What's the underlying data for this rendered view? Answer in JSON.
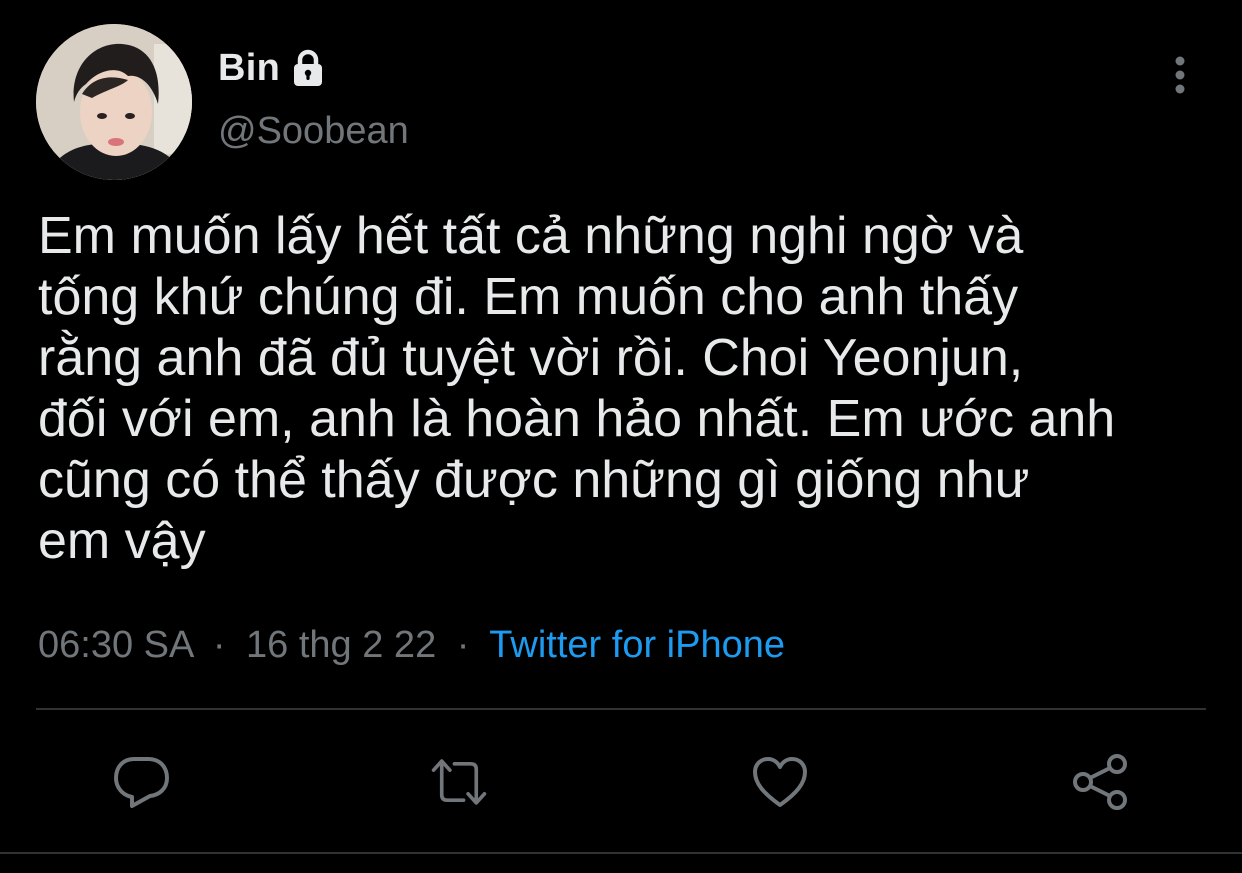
{
  "author": {
    "display_name": "Bin",
    "handle": "@Soobean",
    "protected": true
  },
  "tweet": {
    "text": "Em muốn lấy hết tất cả những nghi ngờ và\ntống khứ chúng đi. Em muốn cho anh thấy\nrằng anh đã đủ tuyệt vời rồi. Choi Yeonjun,\nđối với em, anh là hoàn hảo nhất. Em ước anh\ncũng có thể thấy được những gì giống như\nem vậy",
    "time": "06:30 SA",
    "date": "16 thg 2 22",
    "separator": "·",
    "source": "Twitter for iPhone"
  },
  "icons": {
    "more": "more-vertical-icon",
    "lock": "lock-icon",
    "reply": "reply-icon",
    "retweet": "retweet-icon",
    "like": "heart-icon",
    "share": "share-icon"
  },
  "colors": {
    "background": "#000000",
    "text": "#e7e9ea",
    "secondary_text": "#71767b",
    "link": "#1d9bf0",
    "divider": "#2f3336"
  }
}
